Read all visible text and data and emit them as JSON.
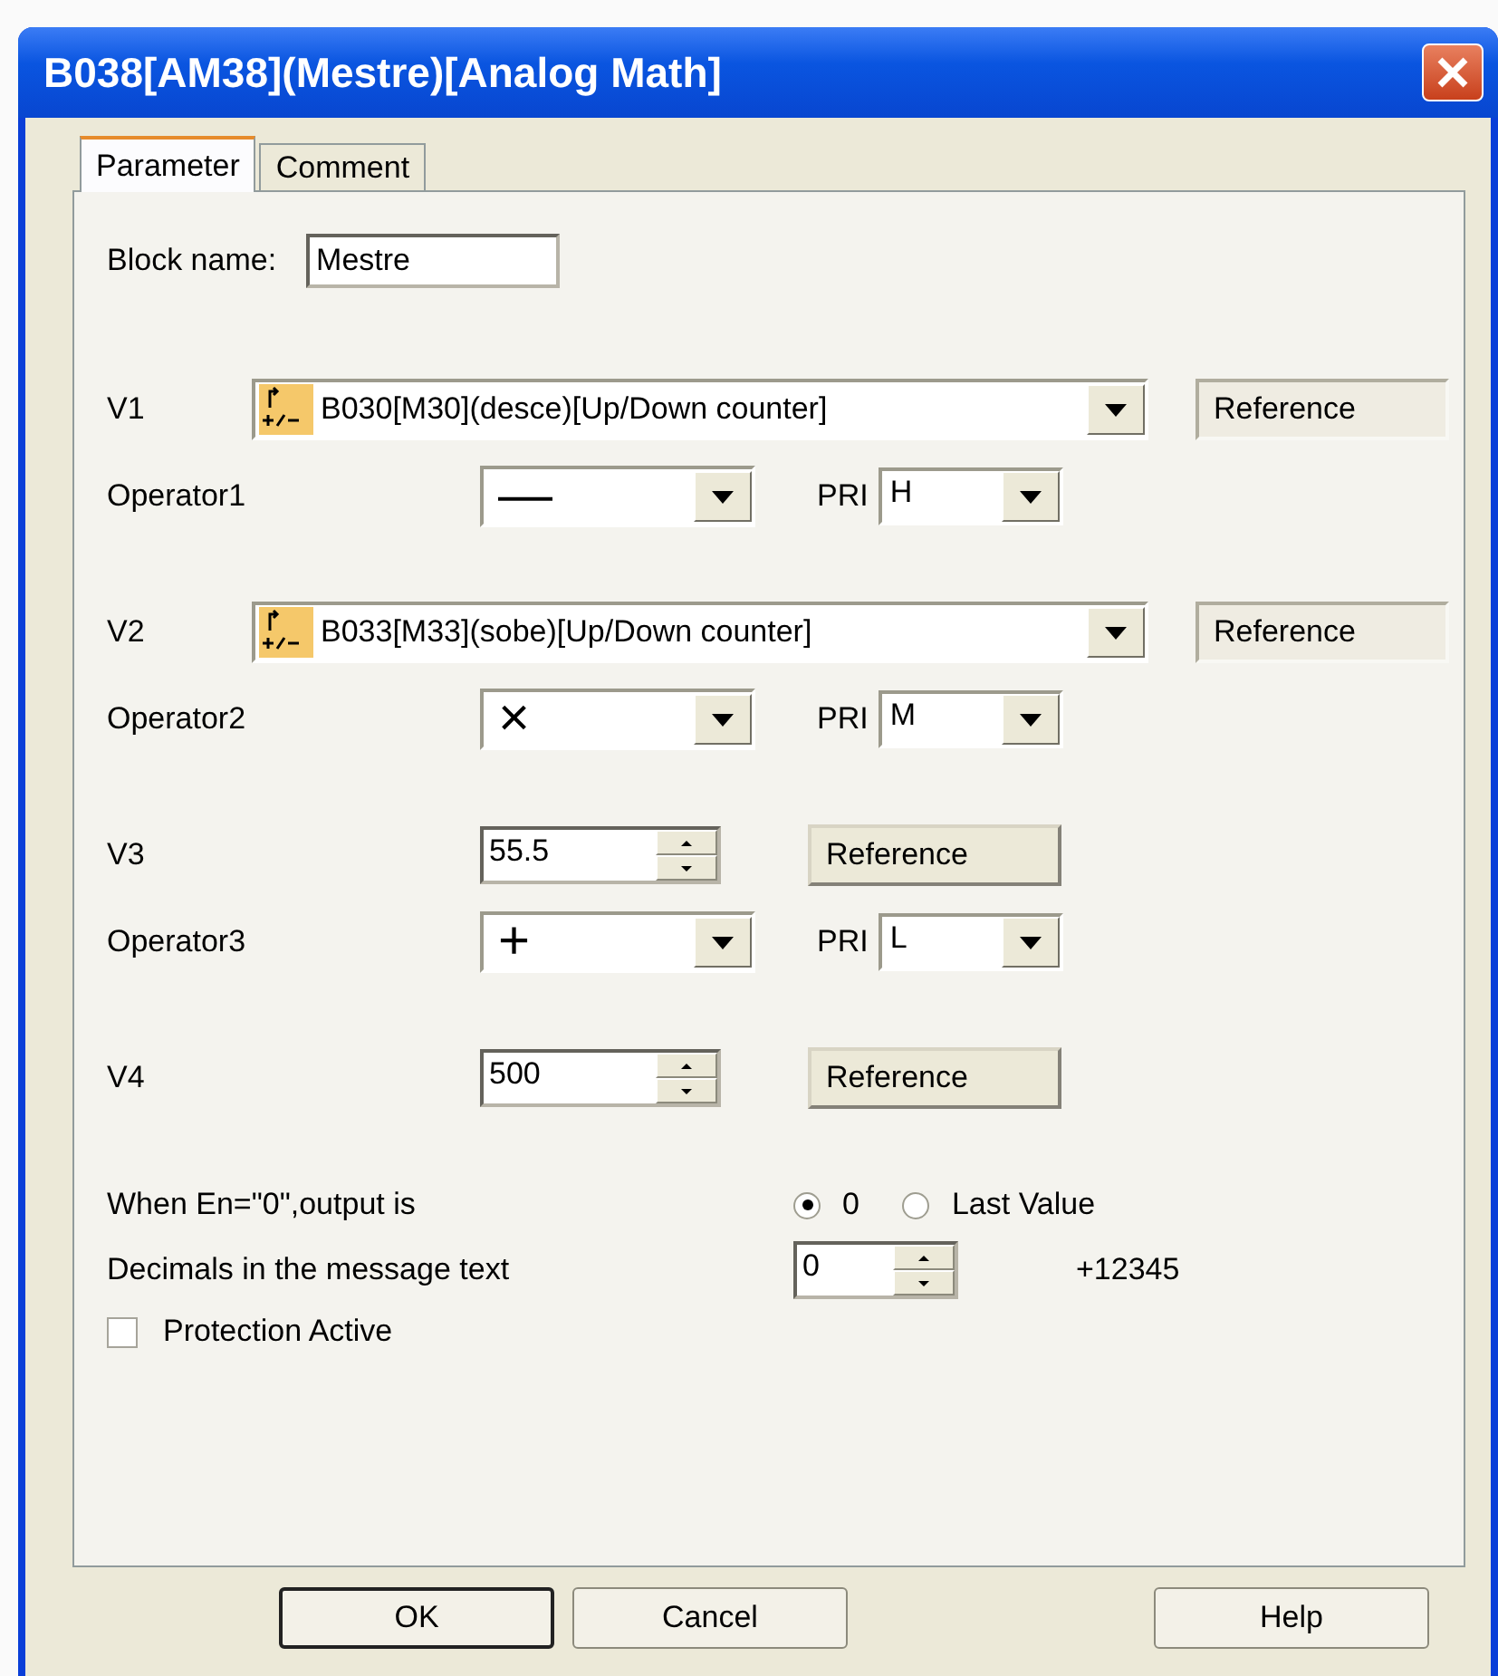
{
  "window": {
    "title": "B038[AM38](Mestre)[Analog Math]"
  },
  "tabs": [
    {
      "label": "Parameter",
      "selected": true
    },
    {
      "label": "Comment",
      "selected": false
    }
  ],
  "block_name": {
    "label": "Block name:",
    "value": "Mestre"
  },
  "rows": [
    {
      "kind": "block",
      "label": "V1",
      "value": "B030[M30](desce)[Up/Down counter]",
      "button": "Reference",
      "disabled": true
    },
    {
      "kind": "operator",
      "label": "Operator1",
      "value": "—",
      "pri_label": "PRI",
      "pri": "H"
    },
    {
      "kind": "block",
      "label": "V2",
      "value": "B033[M33](sobe)[Up/Down counter]",
      "button": "Reference",
      "disabled": true
    },
    {
      "kind": "operator",
      "label": "Operator2",
      "value": "×",
      "pri_label": "PRI",
      "pri": "M"
    },
    {
      "kind": "number",
      "label": "V3",
      "value": "55.5",
      "button": "Reference",
      "disabled": false
    },
    {
      "kind": "operator",
      "label": "Operator3",
      "value": "+",
      "pri_label": "PRI",
      "pri": "L"
    },
    {
      "kind": "number",
      "label": "V4",
      "value": "500",
      "button": "Reference",
      "disabled": false
    }
  ],
  "output": {
    "label": "When En=\"0\",output is",
    "options": [
      {
        "label": "0",
        "selected": true
      },
      {
        "label": "Last Value",
        "selected": false
      }
    ]
  },
  "decimals": {
    "label": "Decimals in the message text",
    "value": "0",
    "preview": "+12345"
  },
  "protection": {
    "label": "Protection Active",
    "checked": false
  },
  "buttons": [
    {
      "label": "OK",
      "default": true
    },
    {
      "label": "Cancel",
      "default": false
    },
    {
      "label": "Help",
      "default": false
    }
  ]
}
